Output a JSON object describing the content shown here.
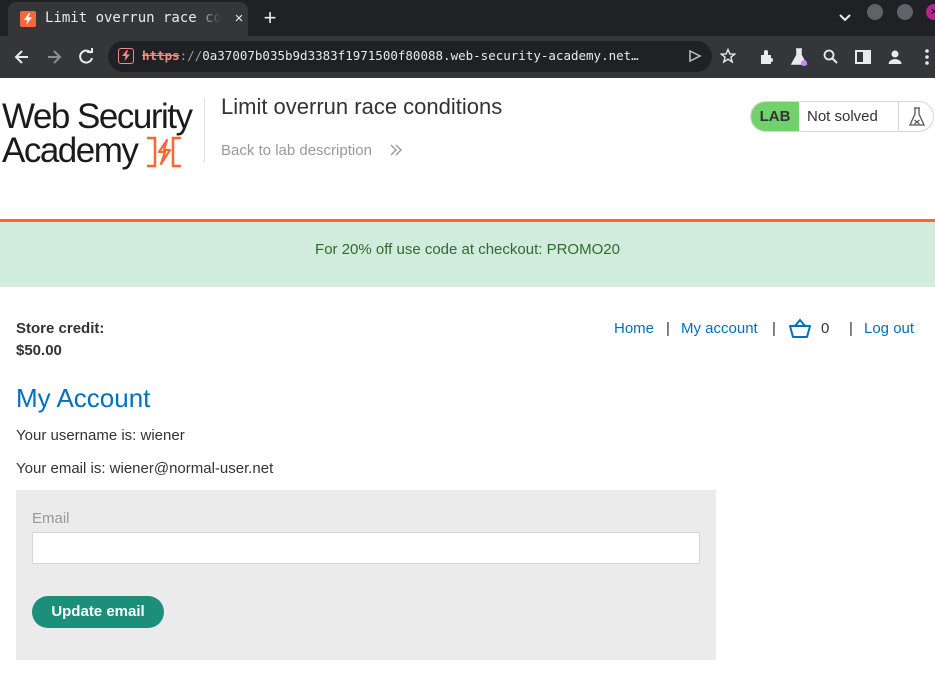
{
  "browser": {
    "tab_title": "Limit overrun race conditions",
    "tab_close_glyph": "×",
    "new_tab_glyph": "+",
    "url_scheme": "https",
    "url_separator": "://",
    "url_rest": "0a37007b035b9d3383f1971500f80088.web-security-academy.net…",
    "icons": [
      "favicon-bolt-icon",
      "close-icon",
      "plus-icon",
      "chevron-down-icon",
      "back-icon",
      "forward-icon",
      "reload-icon",
      "not-secure-icon",
      "send-icon",
      "star-icon",
      "extensions-icon",
      "labs-flask-icon",
      "search-icon",
      "side-panel-icon",
      "profile-icon",
      "kebab-menu-icon"
    ]
  },
  "logo": {
    "line1": "Web Security",
    "line2": "Academy"
  },
  "lab": {
    "title": "Limit overrun race conditions",
    "back_link": "Back to lab description",
    "badge": "LAB",
    "status": "Not solved"
  },
  "promo": {
    "text": "For 20% off use code at checkout: PROMO20"
  },
  "store_credit": {
    "label": "Store credit:",
    "value": "$50.00"
  },
  "nav": {
    "home": "Home",
    "my_account": "My account",
    "cart_count": "0",
    "log_out": "Log out",
    "separator": "|"
  },
  "account": {
    "heading": "My Account",
    "username_line": "Your username is: wiener",
    "email_line": "Your email is: wiener@normal-user.net"
  },
  "email_form": {
    "label": "Email",
    "value": "",
    "placeholder": "",
    "button": "Update email"
  },
  "colors": {
    "brand_orange": "#ff6633",
    "link_blue": "#0071bc",
    "lab_green": "#70d16d",
    "button_teal": "#1c8f7a",
    "promo_bg": "#d1ebdd"
  }
}
